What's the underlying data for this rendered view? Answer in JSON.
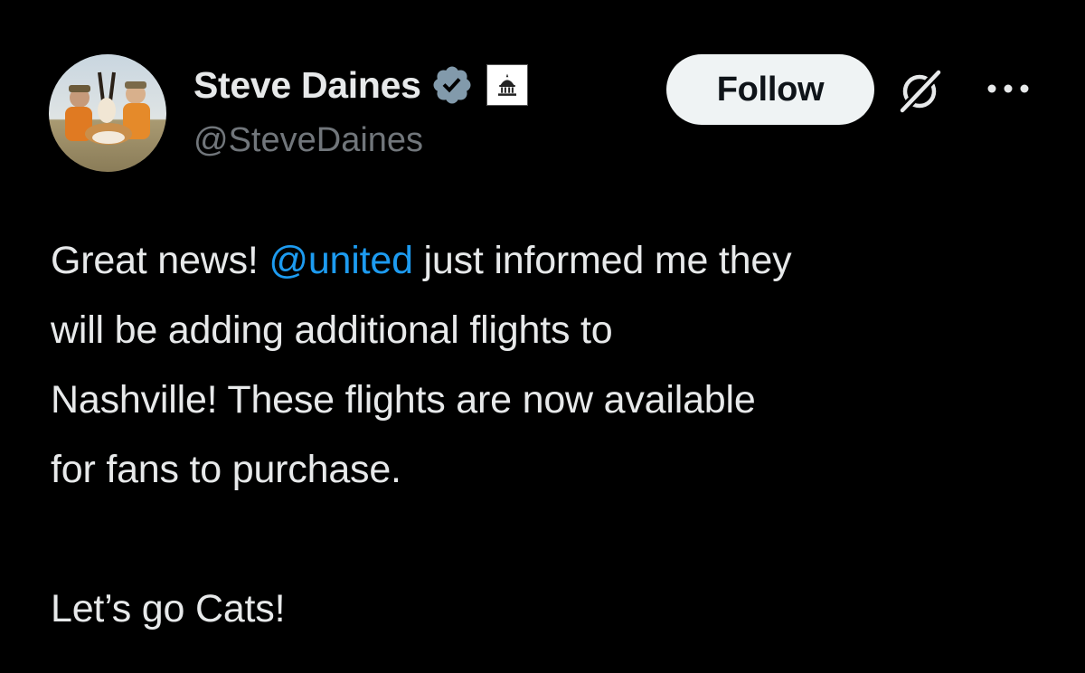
{
  "author": {
    "display_name": "Steve Daines",
    "handle": "@SteveDaines",
    "verified": true,
    "badge_color": "#829aab"
  },
  "actions": {
    "follow_label": "Follow"
  },
  "icons": {
    "verified": "verified-check-icon",
    "affiliation": "capitol-building-icon",
    "grok": "grok-icon",
    "more": "more-horizontal-icon"
  },
  "tweet": {
    "line1_pre": "Great news! ",
    "mention": "@united",
    "line1_post": " just informed me they",
    "line2": "will be adding additional flights to",
    "line3": "Nashville! These flights are now available",
    "line4": "for fans to purchase.",
    "closing": "Let’s go Cats!"
  },
  "colors": {
    "background": "#000000",
    "text": "#e7e9ea",
    "secondary_text": "#71767b",
    "link": "#1d9bf0",
    "button_bg": "#eff3f4",
    "button_text": "#0f1419"
  }
}
